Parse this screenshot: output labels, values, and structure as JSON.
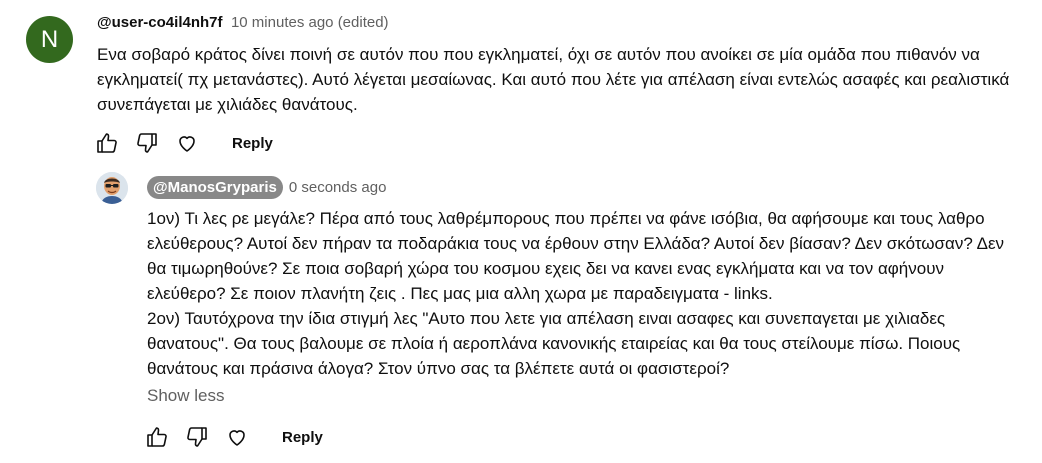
{
  "comment": {
    "avatar_letter": "N",
    "avatar_color": "#33691e",
    "author": "@user-co4il4nh7f",
    "time": "10 minutes ago (edited)",
    "text": "Ενα σοβαρό κράτος δίνει ποινή σε αυτόν που που εγκληματεί, όχι σε αυτόν που ανοίκει σε μία ομάδα που πιθανόν να εγκληματεί( πχ μετανάστες). Αυτό λέγεται μεσαίωνας. Και αυτό που λέτε για απέλαση είναι εντελώς ασαφές και ρεαλιστικά συνεπάγεται με χιλιάδες θανάτους.",
    "reply_label": "Reply",
    "icons": [
      "like-icon",
      "dislike-icon",
      "heart-icon"
    ]
  },
  "reply": {
    "avatar_icon": "user-avatar-icon",
    "author": "@ManosGryparis",
    "time": "0 seconds ago",
    "paragraph1": "1ον) Τι λες ρε μεγάλε? Πέρα από τους λαθρέμπορους που πρέπει να φάνε ισόβια, θα αφήσουμε και τους λαθρο ελεύθερους? Αυτοί δεν πήραν τα ποδαράκια τους να έρθουν στην Ελλάδα? Αυτοί δεν βίασαν? Δεν σκότωσαν? Δεν θα τιμωρηθούνε? Σε ποια σοβαρή χώρα του κοσμου εχεις δει να κανει ενας εγκλήματα και να τον αφήνουν ελεύθερο? Σε ποιον πλανήτη ζεις . Πες μας μια αλλη χωρα με παραδειγματα - links.",
    "paragraph2": "2ον) Ταυτόχρονα την ίδια στιγμή λες \"Αυτο που λετε για απέλαση ειναι ασαφες και συνεπαγεται με χιλιαδες θανατους\". Θα τους βαλουμε σε πλοία ή αεροπλάνα κανονικής εταιρείας και θα τους στείλουμε πίσω. Ποιους θανάτους και πράσινα άλογα? Στον ύπνο σας τα βλέπετε αυτά οι φασιστεροί?",
    "show_less": "Show less",
    "reply_label": "Reply",
    "author_pill_color": "#888888"
  }
}
